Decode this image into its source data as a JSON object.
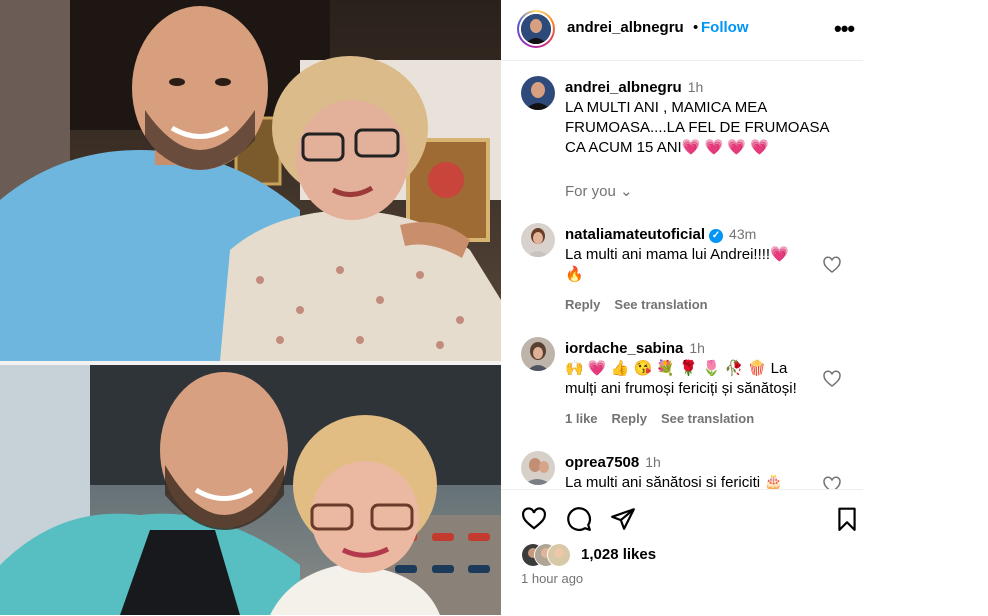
{
  "post": {
    "username": "andrei_albnegru",
    "dot": "•",
    "follow_label": "Follow",
    "more_label": "•••"
  },
  "caption": {
    "username": "andrei_albnegru",
    "time": "1h",
    "text": "LA MULTI ANI , MAMICA MEA FRUMOASA....LA FEL DE FRUMOASA CA ACUM 15 ANI💗 💗 💗 💗"
  },
  "for_you_label": "For you ⌄",
  "comments": [
    {
      "username": "nataliamateutoficial",
      "verified": true,
      "time": "43m",
      "text": "La multi ani mama lui Andrei!!!!💗 🔥",
      "actions": [
        "Reply",
        "See translation"
      ]
    },
    {
      "username": "iordache_sabina",
      "verified": false,
      "time": "1h",
      "text": "🙌 💗 👍 😘 💐 🌹 🌷 🥀 🍿 La mulți ani frumoși fericiți și sănătoși!",
      "actions": [
        "1 like",
        "Reply",
        "See translation"
      ]
    },
    {
      "username": "oprea7508",
      "verified": false,
      "time": "1h",
      "text": "La multi ani sănătosi si fericiti 🎂"
    }
  ],
  "footer": {
    "likes": "1,028 likes",
    "time_ago": "1 hour ago"
  },
  "icons": {
    "like": "heart-outline-icon",
    "comment": "comment-bubble-icon",
    "share": "paper-plane-icon",
    "save": "bookmark-icon"
  },
  "colors": {
    "follow": "#0095f6",
    "secondary_text": "#737373",
    "divider": "#efefef"
  }
}
